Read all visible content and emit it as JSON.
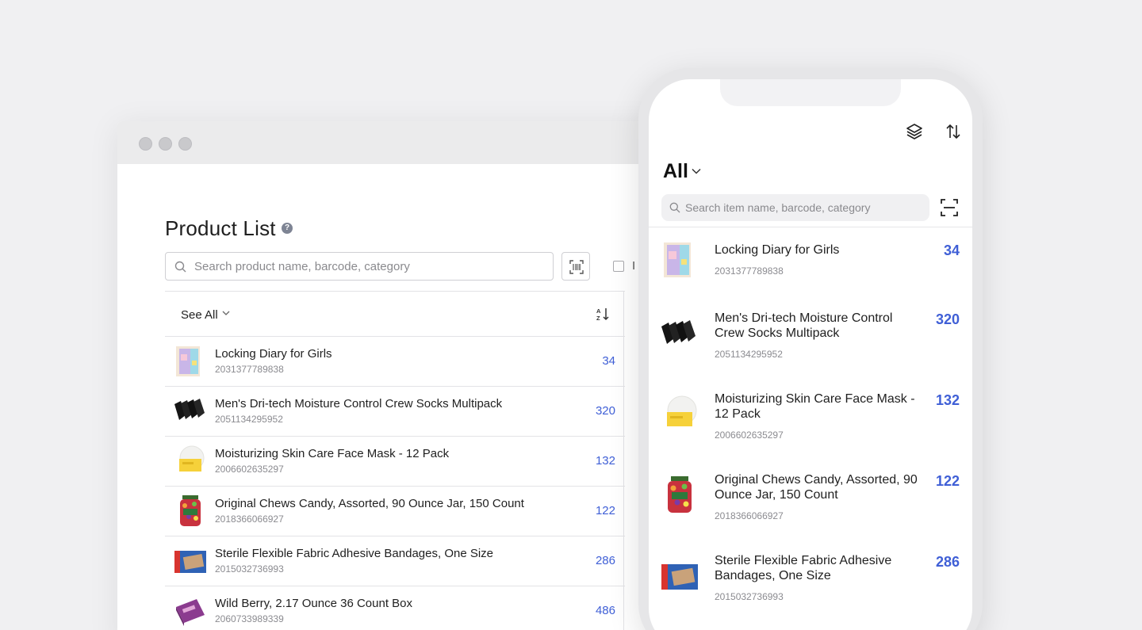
{
  "desktop": {
    "title": "Product List",
    "search": {
      "placeholder": "Search product name, barcode, category"
    },
    "checkbox_label": "I",
    "filter_label": "See All",
    "products": [
      {
        "name": "Locking Diary for Girls",
        "barcode": "2031377789838",
        "qty": "34"
      },
      {
        "name": "Men's Dri-tech Moisture Control Crew Socks Multipack",
        "barcode": "2051134295952",
        "qty": "320"
      },
      {
        "name": "Moisturizing Skin Care Face Mask - 12 Pack",
        "barcode": "2006602635297",
        "qty": "132"
      },
      {
        "name": "Original Chews Candy, Assorted, 90 Ounce Jar, 150 Count",
        "barcode": "2018366066927",
        "qty": "122"
      },
      {
        "name": "Sterile Flexible Fabric Adhesive Bandages, One Size",
        "barcode": "2015032736993",
        "qty": "286"
      },
      {
        "name": "Wild Berry, 2.17 Ounce 36 Count Box",
        "barcode": "2060733989339",
        "qty": "486"
      }
    ]
  },
  "mobile": {
    "title": "All",
    "search": {
      "placeholder": "Search item name, barcode, category"
    },
    "products": [
      {
        "name": "Locking Diary for Girls",
        "barcode": "2031377789838",
        "qty": "34"
      },
      {
        "name": "Men's Dri-tech Moisture Control Crew Socks Multipack",
        "barcode": "2051134295952",
        "qty": "320"
      },
      {
        "name": "Moisturizing Skin Care Face Mask - 12 Pack",
        "barcode": "2006602635297",
        "qty": "132"
      },
      {
        "name": "Original Chews Candy, Assorted, 90 Ounce Jar, 150 Count",
        "barcode": "2018366066927",
        "qty": "122"
      },
      {
        "name": "Sterile Flexible Fabric Adhesive Bandages, One Size",
        "barcode": "2015032736993",
        "qty": "286"
      }
    ]
  },
  "colors": {
    "accent": "#3f5fd6",
    "background": "#f0f0f2"
  },
  "icons": [
    "help-icon",
    "search-icon",
    "barcode-scan-icon",
    "chevron-down-icon",
    "sort-icon",
    "layers-icon",
    "swap-sort-icon"
  ]
}
